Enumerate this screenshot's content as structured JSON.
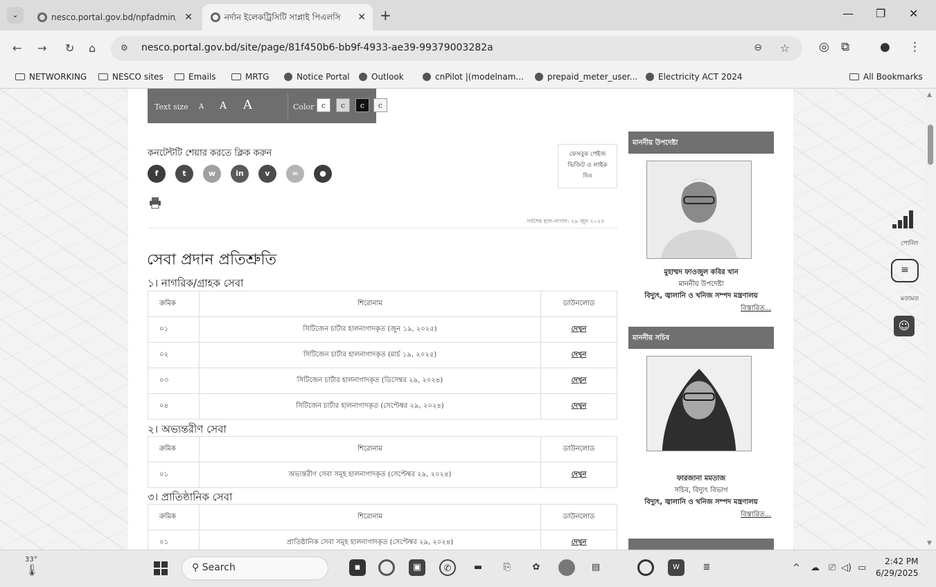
{
  "browser": {
    "tabs": [
      {
        "title": "nesco.portal.gov.bd/npfadmin/",
        "active": false
      },
      {
        "title": "নর্দান ইলেকট্রিসিটি সাপ্লাই পিএলসি",
        "active": true
      }
    ],
    "url": "nesco.portal.gov.bd/site/page/81f450b6-bb9f-4933-ae39-99379003282a",
    "bookmarks": [
      "NETWORKING",
      "NESCO sites",
      "Emails",
      "MRTG",
      "Notice Portal",
      "Outlook",
      "cnPilot |(modelnam...",
      "prepaid_meter_user...",
      "Electricity ACT 2024"
    ],
    "all_bookmarks": "All Bookmarks"
  },
  "accessibility": {
    "text_size_label": "Text size",
    "sizes": [
      "A",
      "A",
      "A"
    ],
    "color_label": "Color",
    "color_options": [
      "c",
      "c",
      "c",
      "c"
    ]
  },
  "share": {
    "title": "কনটেন্টটি শেয়ার করতে ক্লিক করুন",
    "icons": [
      {
        "name": "facebook-icon",
        "glyph": "f",
        "color": "#3c3c3c"
      },
      {
        "name": "twitter-icon",
        "glyph": "t",
        "color": "#4a4a4a"
      },
      {
        "name": "whatsapp-icon",
        "glyph": "w",
        "color": "#a0a0a0"
      },
      {
        "name": "linkedin-icon",
        "glyph": "in",
        "color": "#5a5a5a"
      },
      {
        "name": "viber-icon",
        "glyph": "v",
        "color": "#4c4c4c"
      },
      {
        "name": "link-icon",
        "glyph": "∞",
        "color": "#b4b4b4"
      },
      {
        "name": "messenger-icon",
        "glyph": "●",
        "color": "#3c3c3c"
      }
    ],
    "fb_page_line1": "ফেসবুক পেইজ",
    "fb_page_line2": "ভিজিট ও লাইক",
    "fb_page_line3": "দিন",
    "updated": "সর্বশেষ হাল-নাগাদ: ২৯ জুন ২০২৫"
  },
  "main": {
    "page_title": "সেবা প্রদান প্রতিশ্রুতি",
    "sections": [
      {
        "title": "১। নাগরিক/গ্রাহক সেবা",
        "headers": [
          "ক্রমিক",
          "শিরোনাম",
          "ডাউনলোড"
        ],
        "rows": [
          [
            "০১",
            "সিটিজেন চার্টার হালনাগাদকৃত (জুন ১৯, ২০২৫)",
            "দেখুন"
          ],
          [
            "০২",
            "সিটিজেন চার্টার হালনাগাদকৃত (মার্চ ১৯, ২০২৫)",
            "দেখুন"
          ],
          [
            "০৩",
            "সিটিজেন চার্টার হালনাগাদকৃত (ডিসেম্বর ২৯, ২০২৪)",
            "দেখুন"
          ],
          [
            "০৪",
            "সিটিজেন চার্টার হালনাগাদকৃত (সেপ্টেম্বর ২৯, ২০২৪)",
            "দেখুন"
          ]
        ]
      },
      {
        "title": "২। অভ্যন্তরীণ সেবা",
        "headers": [
          "ক্রমিক",
          "শিরোনাম",
          "ডাউনলোড"
        ],
        "rows": [
          [
            "০১",
            "অভ্যন্তরীণ সেবা সমূহ হালনাগাদকৃত (সেপ্টেম্বর ২৯, ২০২৪)",
            "দেখুন"
          ]
        ]
      },
      {
        "title": "৩। প্রাতিষ্ঠানিক সেবা",
        "headers": [
          "ক্রমিক",
          "শিরোনাম",
          "ডাউনলোড"
        ],
        "rows": [
          [
            "০১",
            "প্রাতিষ্ঠানিক সেবা সমূহ হালনাগাদকৃত (সেপ্টেম্বর ২৯, ২০২৪)",
            "দেখুন"
          ]
        ]
      }
    ]
  },
  "sidebar": {
    "adviser": {
      "heading": "মাননীয় উপদেষ্টা",
      "name": "মুহাম্মদ ফাওজুল কবির খান",
      "title": "মাননীয় উপদেষ্টা",
      "ministry": "বিদ্যুৎ, জ্বালানি ও খনিজ সম্পদ মন্ত্রণালয়",
      "more": "বিস্তারিত..."
    },
    "secretary": {
      "heading": "মাননীয় সচিব",
      "name": "ফারজানা মমতাজ",
      "title": "সচিব, বিদ্যুৎ বিভাগ",
      "ministry": "বিদ্যুৎ, জ্বালানি ও খনিজ সম্পদ মন্ত্রণালয়",
      "more": "বিস্তারিত..."
    }
  },
  "floating": {
    "poll_label": "পোলিং",
    "feedback_label": "মতামত"
  },
  "taskbar": {
    "weather": "33°",
    "search_placeholder": "Search",
    "time": "2:42 PM",
    "date": "6/29/2025"
  }
}
